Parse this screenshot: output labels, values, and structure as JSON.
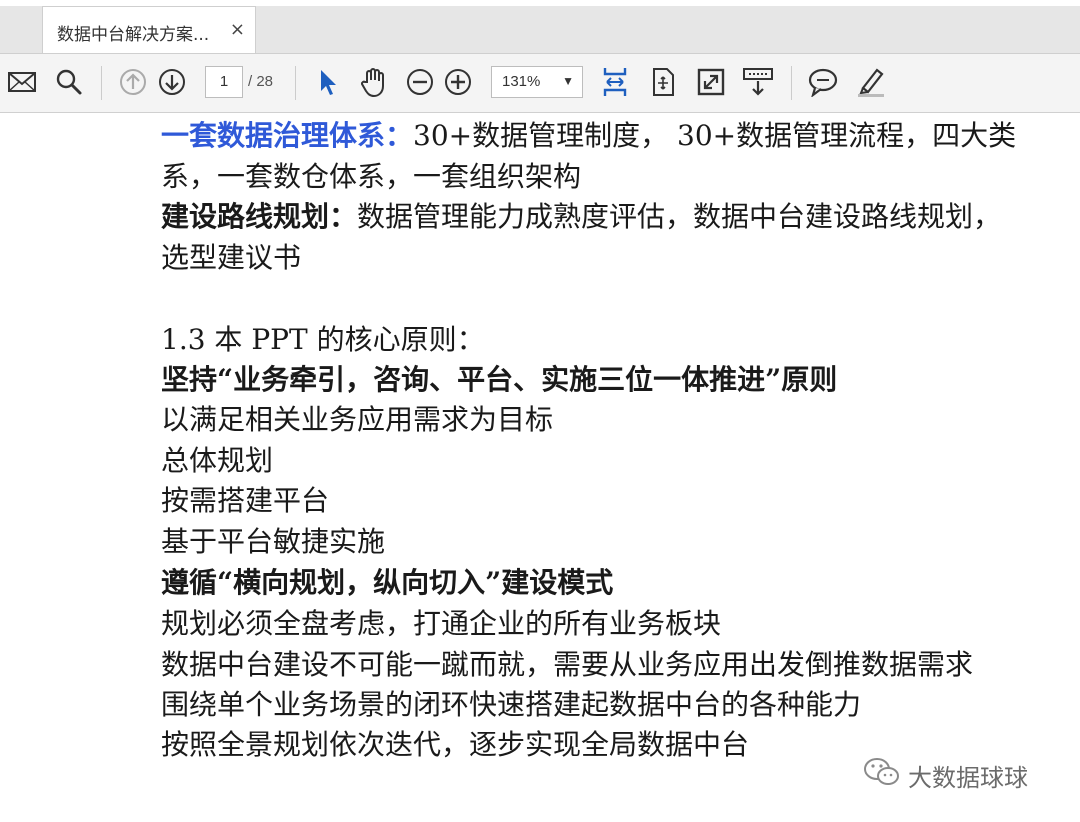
{
  "tab": {
    "title": "数据中台解决方案...",
    "close": "×"
  },
  "toolbar": {
    "page_current": "1",
    "page_total": "/ 28",
    "zoom": "131%",
    "zoom_caret": "▼"
  },
  "document": {
    "line1_bold": "一套数据治理体系：",
    "line1_rest": "30+数据管理制度，  30+数据管理流程，四大类",
    "line2": "系，一套数仓体系，一套组织架构",
    "line3_bold": "建设路线规划：",
    "line3_rest": "数据管理能力成熟度评估，数据中台建设路线规划，",
    "line4": "选型建议书",
    "heading": "1.3  本 PPT 的核心原则：",
    "principle1": "坚持“业务牵引，咨询、平台、实施三位一体推进”原则",
    "p1_items": [
      "以满足相关业务应用需求为目标",
      "总体规划",
      "按需搭建平台",
      "基于平台敏捷实施"
    ],
    "principle2": "遵循“横向规划，纵向切入”建设模式",
    "p2_items": [
      "规划必须全盘考虑，打通企业的所有业务板块",
      "数据中台建设不可能一蹴而就，需要从业务应用出发倒推数据需求",
      "围绕单个业务场景的闭环快速搭建起数据中台的各种能力",
      "按照全景规划依次迭代，逐步实现全局数据中台"
    ]
  },
  "watermark": {
    "text": "大数据球球",
    "icon": "wechat-icon"
  },
  "colors": {
    "highlight_blue": "#2f59d8",
    "select_blue": "#1e5fbf"
  }
}
